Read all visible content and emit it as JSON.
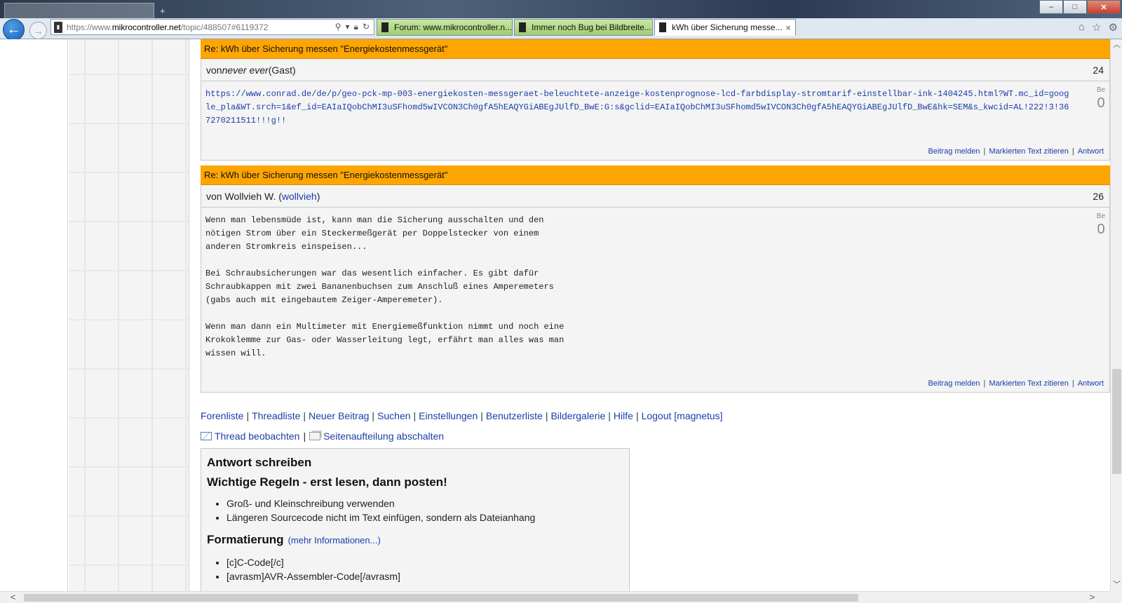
{
  "browser": {
    "tabs": [
      {
        "title": "Forum: www.mikrocontroller.n...",
        "active": false
      },
      {
        "title": "Immer noch Bug bei Bildbreite...",
        "active": false
      },
      {
        "title": "kWh über Sicherung messe...",
        "active": true
      }
    ],
    "close_tab_glyph": "×",
    "address": {
      "prefix": "https://www.",
      "domain": "mikrocontroller.net",
      "path": "/topic/488507#6119372"
    },
    "window_buttons": {
      "minimize": "–",
      "maximize": "□",
      "close": "✕"
    },
    "icons": [
      "home-icon",
      "star-icon",
      "gear-icon",
      "back-icon",
      "forward-icon",
      "search-icon",
      "lock-icon",
      "refresh-icon"
    ]
  },
  "posts": [
    {
      "title": "Re: kWh über Sicherung messen \"Energiekostenmessgerät\"",
      "author_prefix": "von ",
      "author": "never ever",
      "author_suffix": " (Gast)",
      "post_number": "24",
      "body": "https://www.conrad.de/de/p/geo-pck-mp-003-energiekosten-messgeraet-beleuchtete-anzeige-kostenprognose-lcd-farbdisplay-stromtarif-einstellbar-ink-1404245.html?WT.mc_id=google_pla&WT.srch=1&ef_id=EAIaIQobChMI3uSFhomd5wIVCON3Ch0gfA5hEAQYGiABEgJUlfD_BwE:G:s&gclid=EAIaIQobChMI3uSFhomd5wIVCON3Ch0gfA5hEAQYGiABEgJUlfD_BwE&hk=SEM&s_kwcid=AL!222!3!367270211511!!!g!!",
      "rating_label": "Be",
      "rating_value": "0"
    },
    {
      "title": "Re: kWh über Sicherung messen \"Energiekostenmessgerät\"",
      "author_prefix": "von Wollvieh W. (",
      "author": "wollvieh",
      "author_suffix": ")",
      "post_number": "26",
      "body": "Wenn man lebensmüde ist, kann man die Sicherung ausschalten und den\nnötigen Strom über ein Steckermeßgerät per Doppelstecker von einem\nanderen Stromkreis einspeisen...\n\nBei Schraubsicherungen war das wesentlich einfacher. Es gibt dafür\nSchraubkappen mit zwei Bananenbuchsen zum Anschluß eines Amperemeters\n(gabs auch mit eingebautem Zeiger-Amperemeter).\n\nWenn man dann ein Multimeter mit Energiemeßfunktion nimmt und noch eine\nKrokoklemme zur Gas- oder Wasserleitung legt, erfährt man alles was man\nwissen will.",
      "rating_label": "Be",
      "rating_value": "0"
    }
  ],
  "post_actions": {
    "report": "Beitrag melden",
    "quote": "Markierten Text zitieren",
    "reply": "Antwort",
    "separator": "|"
  },
  "forum_nav": {
    "items": [
      "Forenliste",
      "Threadliste",
      "Neuer Beitrag",
      "Suchen",
      "Einstellungen",
      "Benutzerliste",
      "Bildergalerie",
      "Hilfe",
      "Logout [magnetus]"
    ],
    "separator": "|"
  },
  "thread_tools": {
    "watch": "Thread beobachten",
    "separator": "|",
    "pagination_off": "Seitenaufteilung abschalten"
  },
  "reply": {
    "title": "Antwort schreiben",
    "rules_title": "Wichtige Regeln - erst lesen, dann posten!",
    "rules": [
      "Groß- und Kleinschreibung verwenden",
      "Längeren Sourcecode nicht im Text einfügen, sondern als Dateianhang"
    ],
    "format_title": "Formatierung",
    "format_more": "(mehr Informationen...)",
    "format_items": [
      "[c]C-Code[/c]",
      "[avrasm]AVR-Assembler-Code[/avrasm]"
    ]
  },
  "scrollbar_glyphs": {
    "up": "︿",
    "down": "﹀",
    "left": "<",
    "right": ">"
  },
  "colors": {
    "post_header": "#ffa500",
    "link": "#1a3ea8",
    "active_tab": "#ffffff",
    "inactive_tab": "#a8d57a"
  }
}
